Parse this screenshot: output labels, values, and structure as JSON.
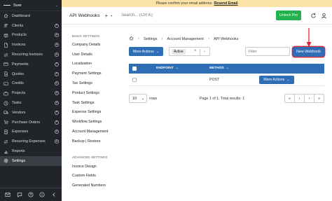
{
  "sidebar": {
    "company": "Sure",
    "items": [
      {
        "label": "Dashboard",
        "icon": "home-icon",
        "plus": false,
        "active": false
      },
      {
        "label": "Clients",
        "icon": "users-icon",
        "plus": true,
        "active": false
      },
      {
        "label": "Products",
        "icon": "box-icon",
        "plus": true,
        "active": false
      },
      {
        "label": "Invoices",
        "icon": "file-icon",
        "plus": true,
        "active": false
      },
      {
        "label": "Recurring Invoices",
        "icon": "repeat-icon",
        "plus": true,
        "active": false
      },
      {
        "label": "Payments",
        "icon": "credit-card-icon",
        "plus": true,
        "active": false
      },
      {
        "label": "Quotes",
        "icon": "file-text-icon",
        "plus": true,
        "active": false
      },
      {
        "label": "Credits",
        "icon": "credit-icon",
        "plus": true,
        "active": false
      },
      {
        "label": "Projects",
        "icon": "briefcase-icon",
        "plus": true,
        "active": false
      },
      {
        "label": "Tasks",
        "icon": "clock-icon",
        "plus": true,
        "active": false
      },
      {
        "label": "Vendors",
        "icon": "truck-icon",
        "plus": true,
        "active": false
      },
      {
        "label": "Purchase Orders",
        "icon": "shopping-cart-icon",
        "plus": true,
        "active": false
      },
      {
        "label": "Expenses",
        "icon": "receipt-icon",
        "plus": true,
        "active": false
      },
      {
        "label": "Recurring Expenses",
        "icon": "repeat-icon",
        "plus": true,
        "active": false
      },
      {
        "label": "Reports",
        "icon": "chart-icon",
        "plus": false,
        "active": false
      },
      {
        "label": "Settings",
        "icon": "gear-icon",
        "plus": false,
        "active": true
      }
    ],
    "footer_icons": [
      "mail-icon",
      "chat-icon",
      "question-icon",
      "info-icon",
      "chevron-left-icon"
    ]
  },
  "banner": {
    "text": "Please confirm your email address.",
    "link": "Resend Email"
  },
  "header": {
    "title": "API Webhooks",
    "add_label": "+",
    "search_placeholder": "Search... (Ctrl K)",
    "unlock_label": "Unlock Pro"
  },
  "settings_menu": {
    "basic_heading": "BASIC SETTINGS",
    "basic_items": [
      "Company Details",
      "User Details",
      "Localization",
      "Payment Settings",
      "Tax Settings",
      "Product Settings",
      "Task Settings",
      "Expense Settings",
      "Workflow Settings",
      "Account Management",
      "Backup | Restore"
    ],
    "advanced_heading": "ADVANCED SETTINGS",
    "advanced_items": [
      "Invoice Design",
      "Custom Fields",
      "Generated Numbers"
    ]
  },
  "breadcrumb": [
    "Settings",
    "Account Management",
    "API Webhooks"
  ],
  "toolbar": {
    "more_actions": "More Actions",
    "status_chip": "Active",
    "filter_placeholder": "Filter",
    "new_webhook": "New Webhook"
  },
  "table": {
    "columns": [
      "ENDPOINT",
      "METHOD"
    ],
    "rows": [
      {
        "endpoint": "",
        "method": "POST",
        "actions": "More Actions"
      }
    ]
  },
  "pagination": {
    "rows_value": "10",
    "rows_label": "rows",
    "page_info": "Page 1 of 1. Total results: 1",
    "controls": [
      "«",
      "‹",
      "›",
      "»"
    ]
  },
  "colors": {
    "sidebar_bg": "#212529",
    "primary": "#2f6eb5",
    "unlock_green": "#22b14c",
    "banner_bg": "#fbe3a6",
    "annotation_red": "#d9253a"
  }
}
